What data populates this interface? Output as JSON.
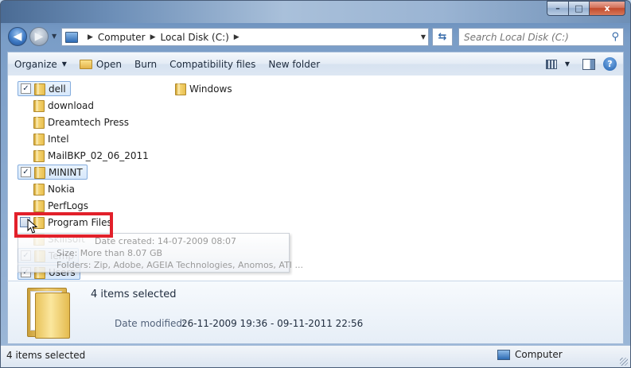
{
  "window": {
    "caption_buttons": {
      "minimize": "–",
      "maximize": "□",
      "close": "x"
    }
  },
  "nav": {
    "back_glyph": "◀",
    "forward_glyph": "▶",
    "breadcrumb": [
      "Computer",
      "Local Disk (C:)"
    ],
    "search_placeholder": "Search Local Disk (C:)"
  },
  "toolbar": {
    "organize": "Organize",
    "open": "Open",
    "burn": "Burn",
    "compatibility": "Compatibility files",
    "new_folder": "New folder",
    "help": "?"
  },
  "files": [
    {
      "name": "dell",
      "selected": true,
      "checked": true
    },
    {
      "name": "download",
      "selected": false,
      "checked": false
    },
    {
      "name": "Dreamtech Press",
      "selected": false,
      "checked": false
    },
    {
      "name": "Intel",
      "selected": false,
      "checked": false
    },
    {
      "name": "MailBKP_02_06_2011",
      "selected": false,
      "checked": false
    },
    {
      "name": "MININT",
      "selected": true,
      "checked": true
    },
    {
      "name": "Nokia",
      "selected": false,
      "checked": false
    },
    {
      "name": "PerfLogs",
      "selected": false,
      "checked": false
    },
    {
      "name": "Program Files",
      "selected": false,
      "checked": false
    },
    {
      "name": "Skillsoft",
      "selected": false,
      "checked": false
    },
    {
      "name": "Temp",
      "selected": true,
      "checked": true
    },
    {
      "name": "Users",
      "selected": true,
      "checked": true
    },
    {
      "name": "Windows",
      "selected": false,
      "checked": false
    }
  ],
  "tooltip": {
    "line1": "Date created: 14-07-2009 08:07",
    "line2": "Size: More than 8.07 GB",
    "line3": "Folders: Zip, Adobe, AGEIA Technologies, Anomos, ATI ..."
  },
  "details": {
    "count": "4 items selected",
    "date_label": "Date modified:",
    "date_value": "26-11-2009 19:36 - 09-11-2011 22:56"
  },
  "status": {
    "left": "4 items selected",
    "right": "Computer"
  },
  "colors": {
    "highlight_box": "#e2202a",
    "selection_fill": "#d7e8fb"
  }
}
